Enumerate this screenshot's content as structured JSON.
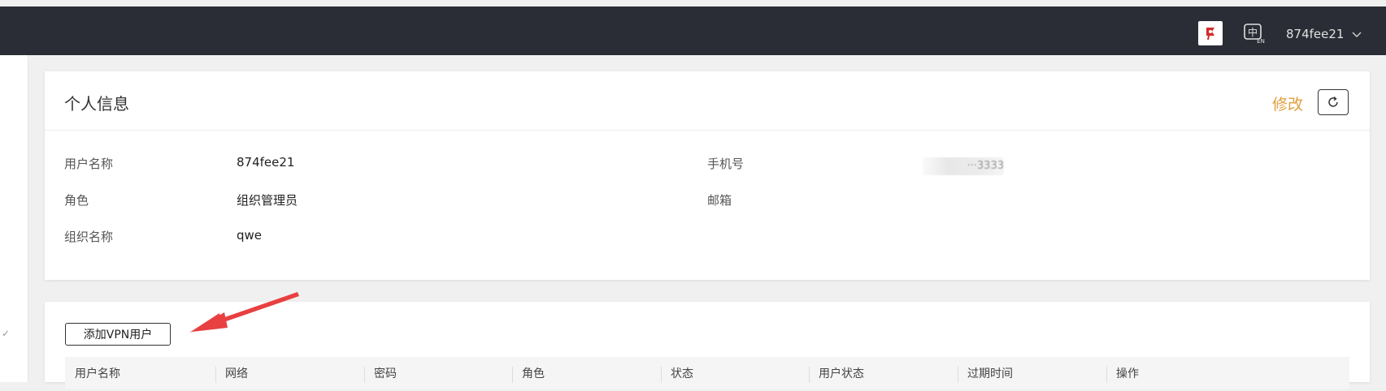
{
  "header": {
    "username": "874fee21",
    "flag_icon": "flag-icon",
    "language_icon": "language-switch-icon",
    "language_label": "中",
    "language_sub": "EN",
    "dropdown_icon": "chevron-down-icon"
  },
  "profile": {
    "title": "个人信息",
    "edit_label": "修改",
    "refresh_icon": "refresh-icon",
    "fields": {
      "username_label": "用户名称",
      "username_value": "874fee21",
      "role_label": "角色",
      "role_value": "组织管理员",
      "org_label": "组织名称",
      "org_value": "qwe",
      "phone_label": "手机号",
      "phone_value": "···3333",
      "email_label": "邮箱",
      "email_value": ""
    }
  },
  "vpn": {
    "add_button_label": "添加VPN用户",
    "columns": [
      "用户名称",
      "网络",
      "密码",
      "角色",
      "状态",
      "用户状态",
      "过期时间",
      "操作"
    ]
  },
  "colors": {
    "topbar": "#2a2d35",
    "accent": "#e0a040",
    "annotation_arrow": "#e84040"
  }
}
